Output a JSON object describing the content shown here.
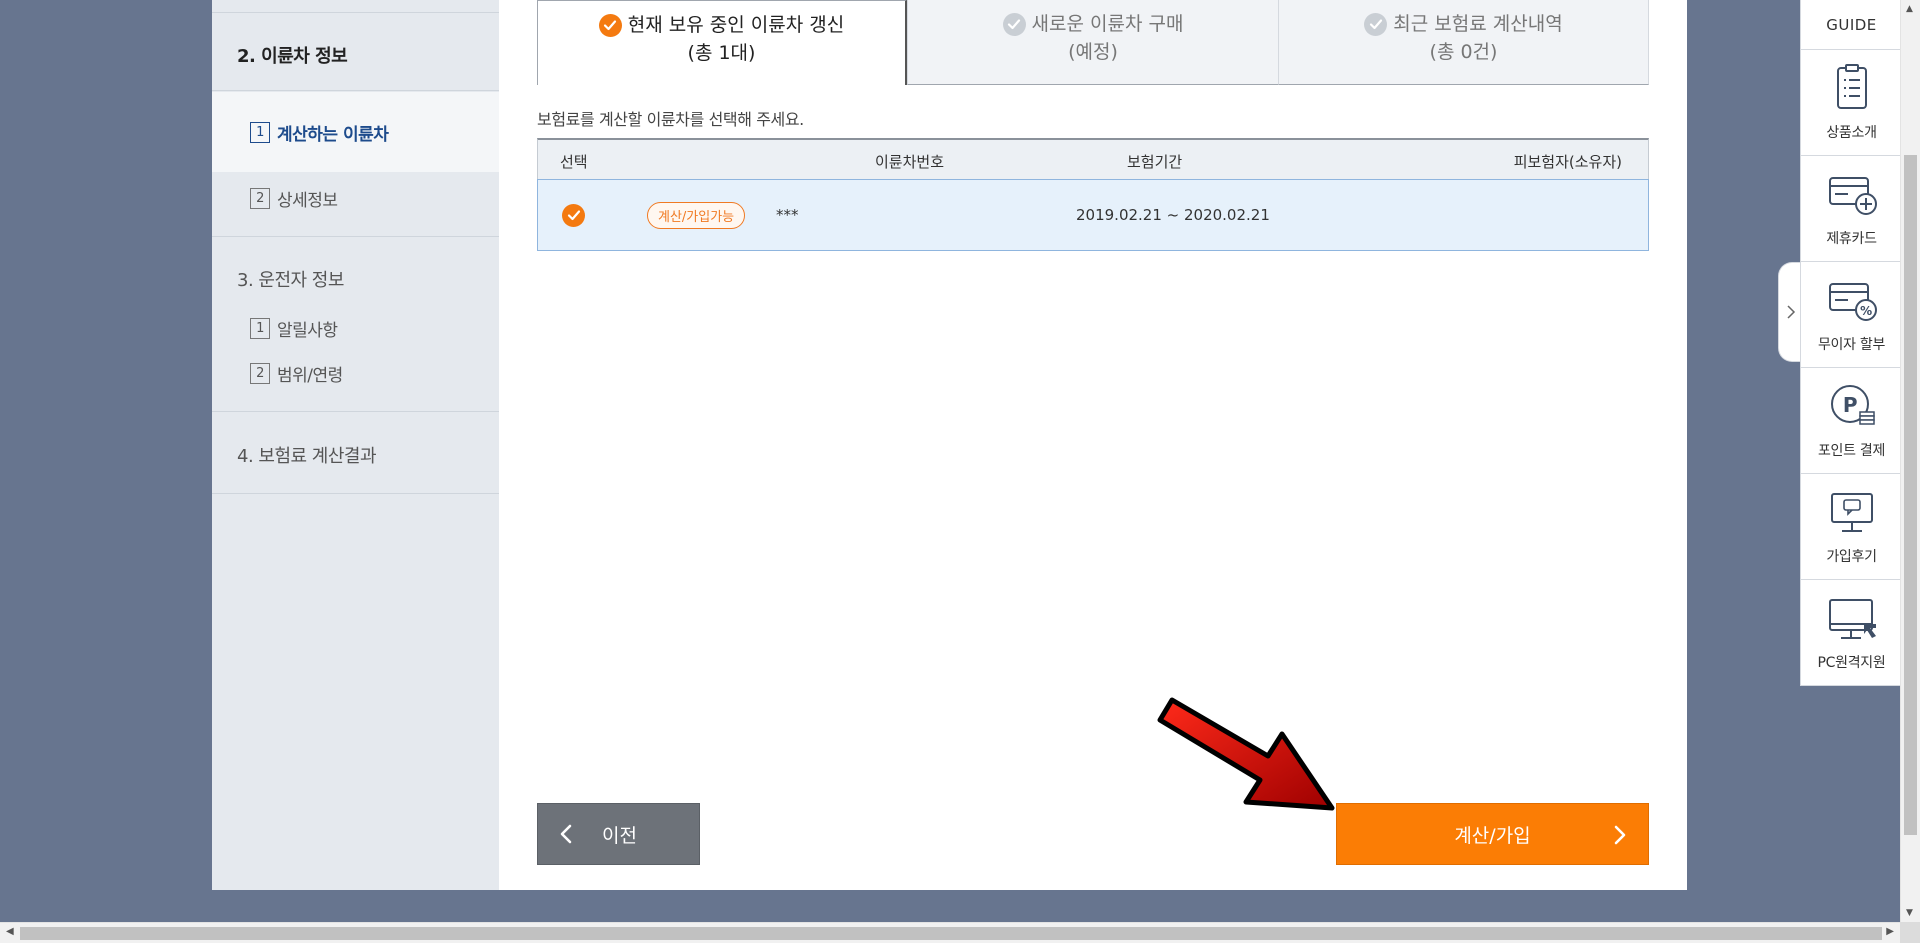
{
  "sidebar": {
    "step2": "2. 이륜차 정보",
    "step2_subs": [
      {
        "num": "1",
        "label": "계산하는 이륜차"
      },
      {
        "num": "2",
        "label": "상세정보"
      }
    ],
    "step3": "3. 운전자 정보",
    "step3_subs": [
      {
        "num": "1",
        "label": "알릴사항"
      },
      {
        "num": "2",
        "label": "범위/연령"
      }
    ],
    "step4": "4. 보험료 계산결과"
  },
  "tabs": [
    {
      "title": "현재 보유 중인 이륜차 갱신",
      "sub": "(총 1대)"
    },
    {
      "title": "새로운 이륜차 구매",
      "sub": "(예정)"
    },
    {
      "title": "최근 보험료 계산내역",
      "sub": "(총 0건)"
    }
  ],
  "guide_text": "보험료를 계산할 이륜차를 선택해 주세요.",
  "table": {
    "headers": {
      "select": "선택",
      "vehicle_no": "이륜차번호",
      "period": "보험기간",
      "insured": "피보험자(소유자)"
    },
    "row": {
      "badge": "계산/가입가능",
      "vehicle_no": "***",
      "period": "2019.02.21 ~ 2020.02.21",
      "insured": ""
    }
  },
  "buttons": {
    "prev": "이전",
    "next": "계산/가입"
  },
  "guide_panel": {
    "title": "GUIDE",
    "items": [
      "상품소개",
      "제휴카드",
      "무이자 할부",
      "포인트 결제",
      "가입후기",
      "PC원격지원"
    ]
  },
  "colors": {
    "accent": "#fb7d05",
    "nav_active": "#1d4b8c",
    "background": "#67758f"
  }
}
